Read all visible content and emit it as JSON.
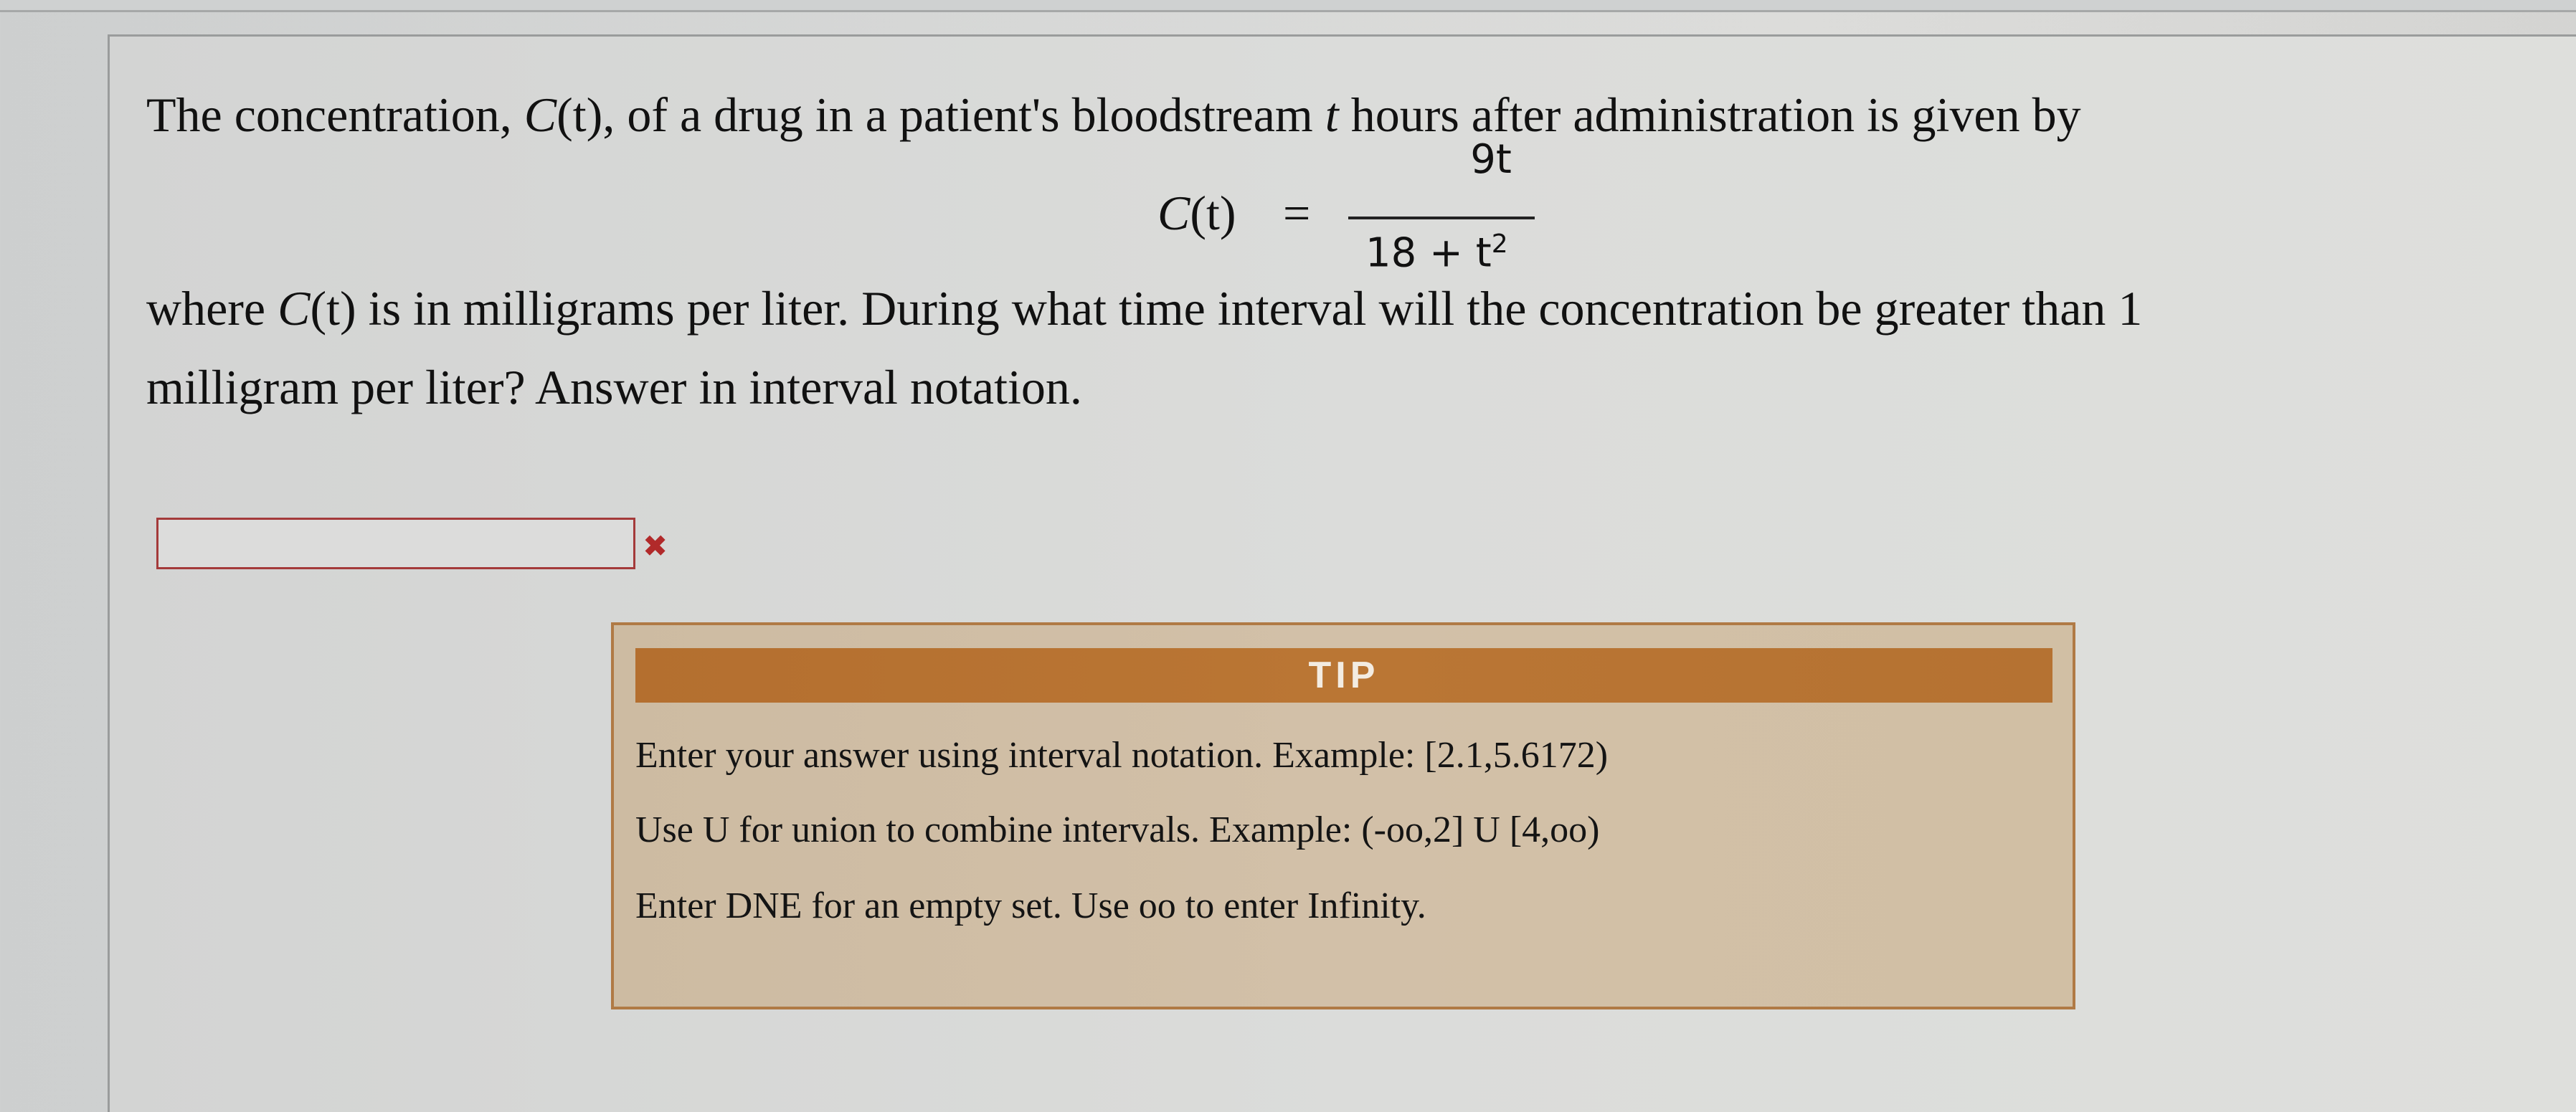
{
  "problem": {
    "line1_prefix": "The concentration, ",
    "line1_func": "C",
    "line1_arg": "(t)",
    "line1_mid": ", of a drug in a patient's bloodstream ",
    "line1_var": "t",
    "line1_suffix": " hours after administration is given by",
    "formula_lhs_func": "C",
    "formula_lhs_arg": "(t)",
    "formula_eq": "=",
    "formula_numerator": "9t",
    "formula_denominator_base": "18 + t",
    "formula_denominator_exp": "2",
    "line2_prefix": "where ",
    "line2_func": "C",
    "line2_arg": "(t)",
    "line2_suffix": " is in milligrams per liter. During what time interval will the concentration be greater than 1",
    "line3": "milligram per liter? Answer in interval notation."
  },
  "answer": {
    "value": "",
    "placeholder": "",
    "status_icon": "x-error-icon"
  },
  "tip": {
    "header": "TIP",
    "line1": "Enter your answer using interval notation. Example: [2.1,5.6172)",
    "line2": "Use U for union to combine intervals. Example: (-oo,2] U [4,oo)",
    "line3": "Enter DNE for an empty set. Use oo to enter Infinity."
  },
  "colors": {
    "tip_header_bg": "#b87332",
    "tip_box_bg": "#d0bea5",
    "input_border_error": "#a43a3a",
    "error_icon": "#b12a2a"
  }
}
